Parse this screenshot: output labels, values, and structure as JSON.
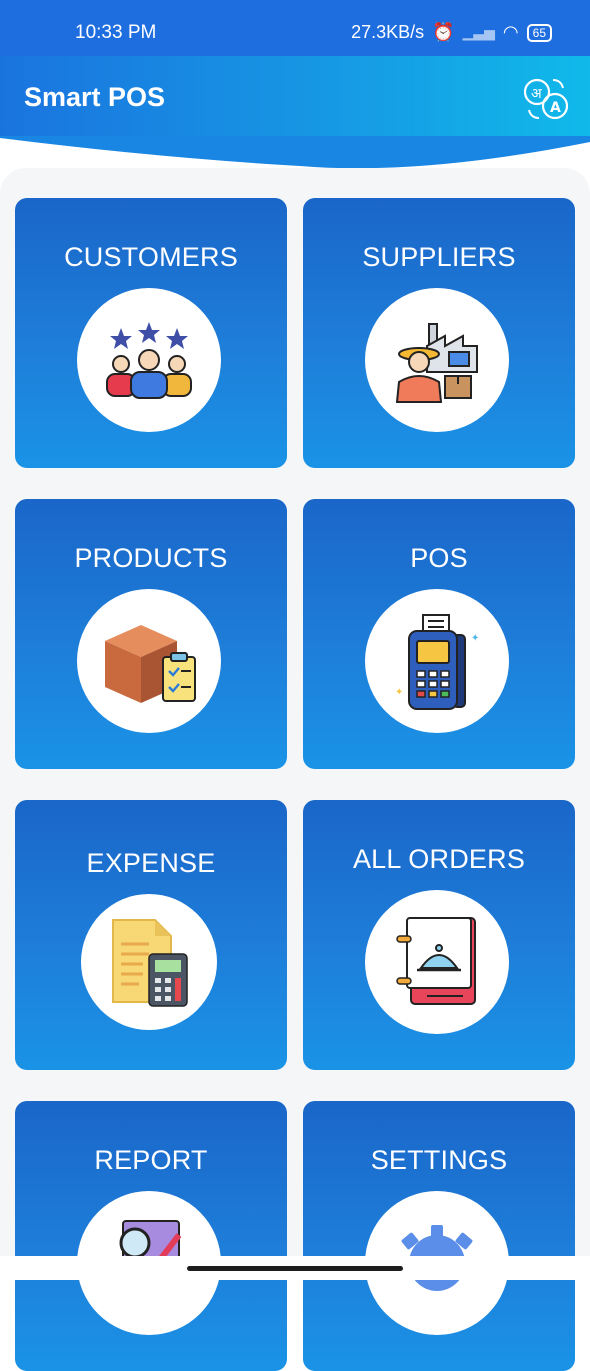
{
  "status_bar": {
    "time": "10:33 PM",
    "net_speed": "27.3KB/s",
    "battery": "65"
  },
  "app_bar": {
    "title": "Smart POS"
  },
  "menu": [
    {
      "label": "CUSTOMERS",
      "icon": "customers-icon"
    },
    {
      "label": "SUPPLIERS",
      "icon": "supplier-icon"
    },
    {
      "label": "PRODUCTS",
      "icon": "products-box-icon"
    },
    {
      "label": "POS",
      "icon": "pos-terminal-icon"
    },
    {
      "label": "EXPENSE",
      "icon": "expense-calculator-icon"
    },
    {
      "label": "ALL ORDERS",
      "icon": "orders-book-icon"
    },
    {
      "label": "REPORT",
      "icon": "report-icon"
    },
    {
      "label": "SETTINGS",
      "icon": "settings-gear-icon"
    }
  ],
  "colors": {
    "primary": "#1a6fd6",
    "card_top": "#1a66c9",
    "card_bottom": "#1a93e6",
    "background": "#f4f6f8"
  }
}
